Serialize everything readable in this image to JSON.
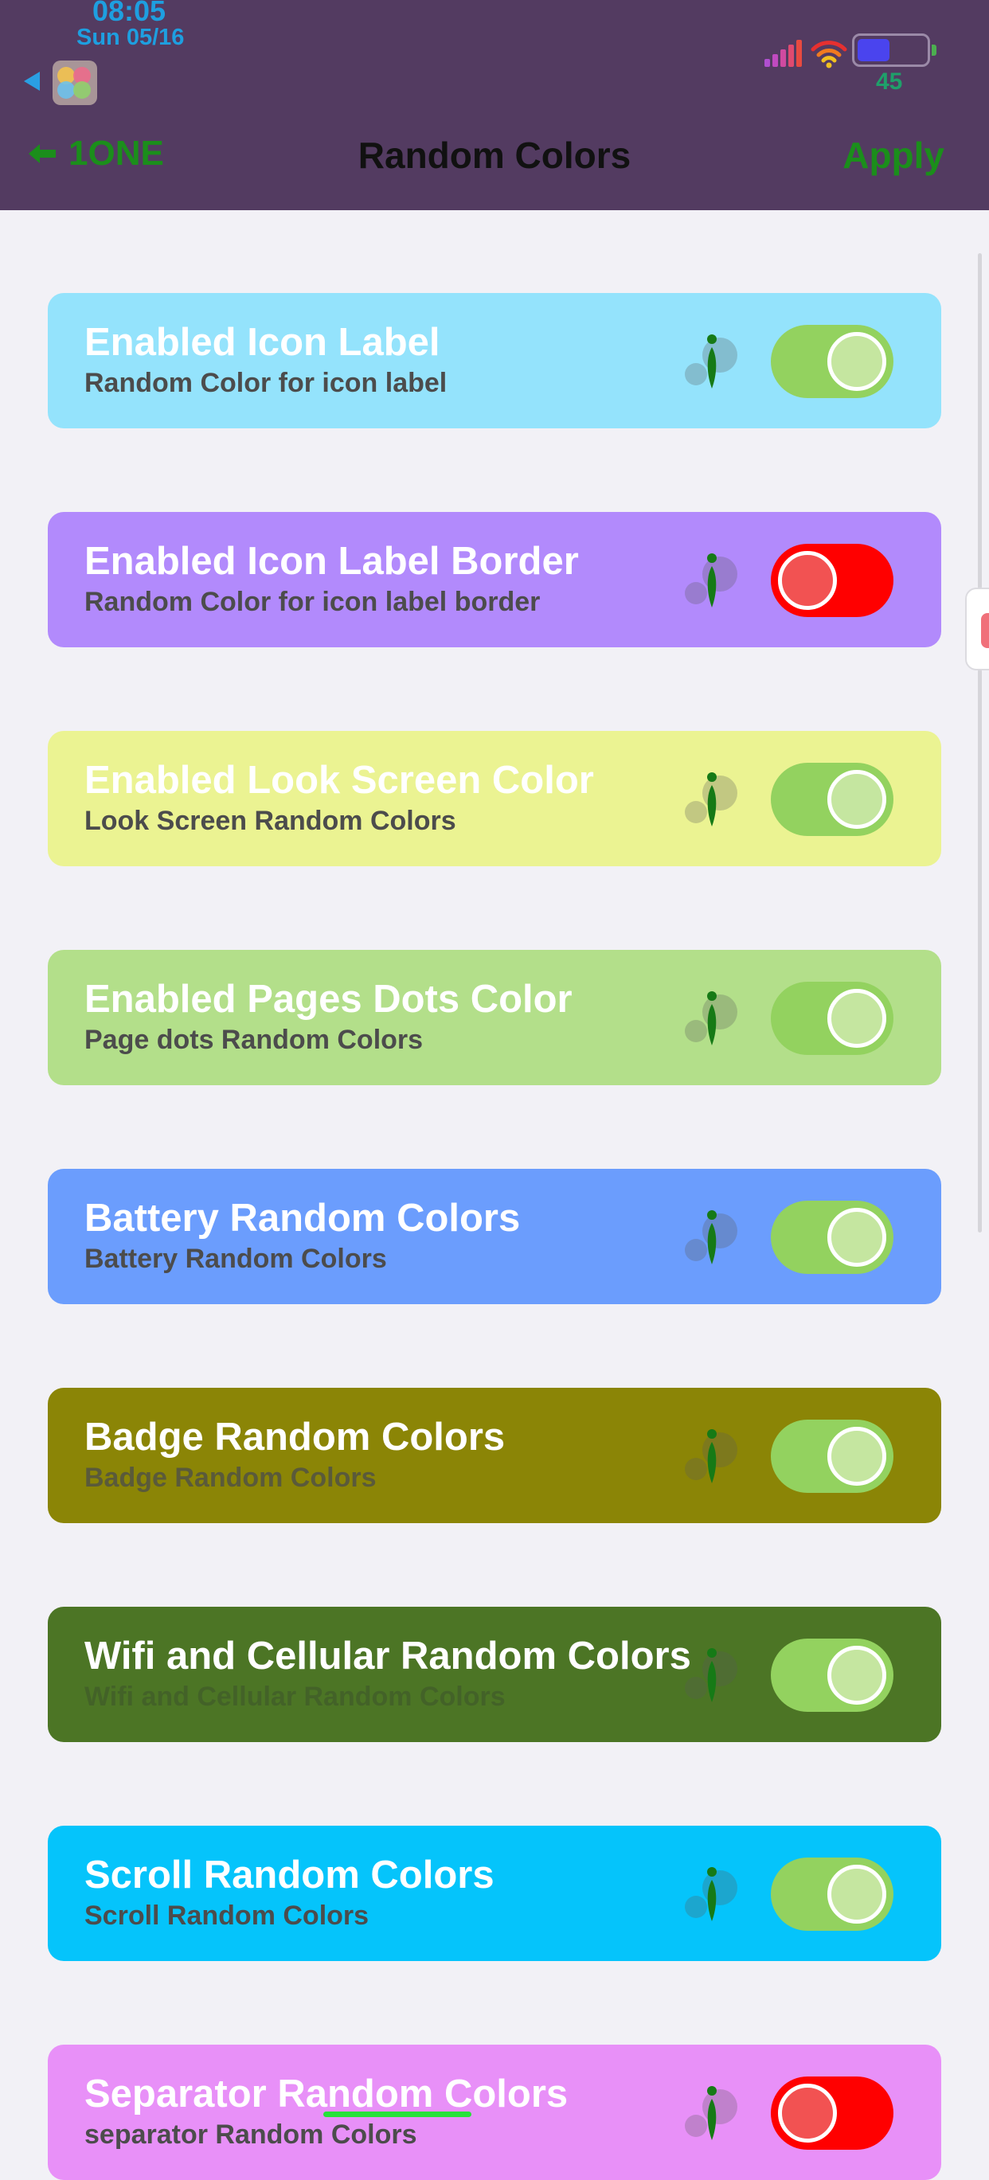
{
  "status_bar": {
    "time": "08:05",
    "date": "Sun 05/16",
    "battery_level": "45",
    "signal_icon": "cellular-signal-icon",
    "wifi_icon": "wifi-icon",
    "battery_icon": "battery-icon"
  },
  "nav": {
    "back_label": "1ONE",
    "back_icon": "arrow-left-icon",
    "title": "Random Colors",
    "apply_label": "Apply"
  },
  "colors": {
    "header_bg": "#533b61",
    "page_bg": "#f2f1f6",
    "accent_green": "#1b8e1b",
    "toggle_on": "#93d25f",
    "toggle_off": "#ff0000"
  },
  "settings": [
    {
      "title": "Enabled Icon Label",
      "subtitle": "Random Color for icon label",
      "enabled": true,
      "bg": "#94e3fc",
      "subtitle_color": "#4c4c4c"
    },
    {
      "title": "Enabled Icon Label Border",
      "subtitle": "Random Color for icon label border",
      "enabled": false,
      "bg": "#b28afc",
      "subtitle_color": "#4c4c4c"
    },
    {
      "title": "Enabled Look Screen Color",
      "subtitle": "Look Screen Random Colors",
      "enabled": true,
      "bg": "#ebf392",
      "subtitle_color": "#4c4c4c"
    },
    {
      "title": "Enabled Pages Dots Color",
      "subtitle": "Page dots Random Colors",
      "enabled": true,
      "bg": "#b3df8a",
      "subtitle_color": "#4c4c4c"
    },
    {
      "title": "Battery Random Colors",
      "subtitle": "Battery Random Colors",
      "enabled": true,
      "bg": "#6b9dfd",
      "subtitle_color": "#4c4c4c"
    },
    {
      "title": "Badge Random Colors",
      "subtitle": "Badge Random Colors",
      "enabled": true,
      "bg": "#8b8506",
      "subtitle_color": "#5a5a3a"
    },
    {
      "title": "Wifi and Cellular Random Colors",
      "subtitle": "Wifi and Cellular Random Colors",
      "enabled": true,
      "bg": "#4c7525",
      "subtitle_color": "#436228"
    },
    {
      "title": "Scroll Random Colors",
      "subtitle": "Scroll Random Colors",
      "enabled": true,
      "bg": "#05c4fb",
      "subtitle_color": "#4c4c4c"
    },
    {
      "title": "Separator Random Colors",
      "subtitle": "separator Random Colors",
      "enabled": false,
      "bg": "#e890f8",
      "subtitle_color": "#4c4c4c"
    }
  ]
}
